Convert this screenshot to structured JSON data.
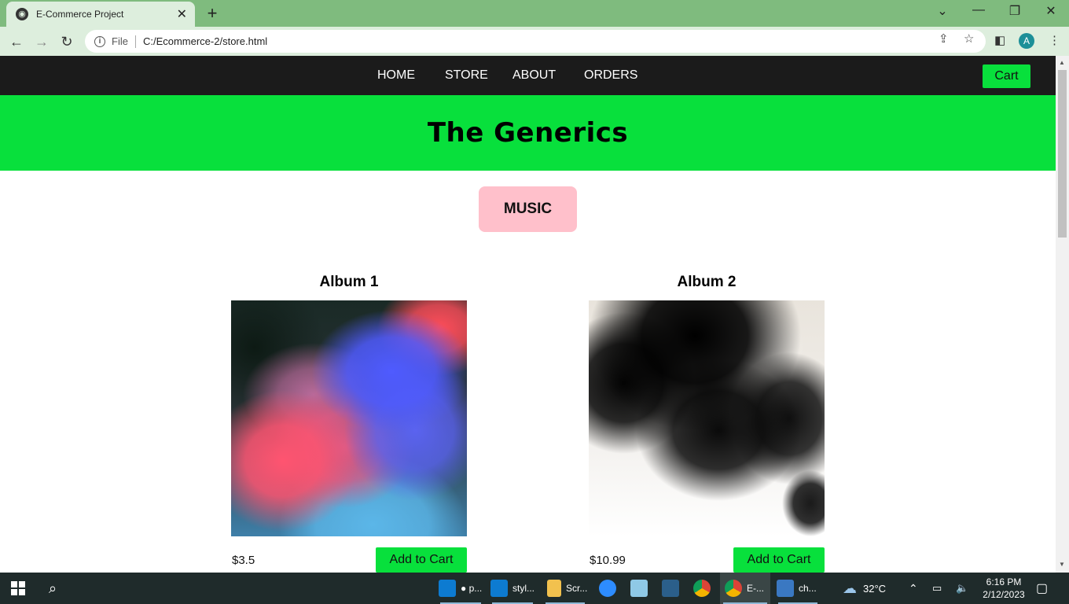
{
  "browser": {
    "tab_title": "E-Commerce Project",
    "url_scheme": "File",
    "url": "C:/Ecommerce-2/store.html",
    "profile_initial": "A"
  },
  "site": {
    "nav": [
      "HOME",
      "STORE",
      "ABOUT",
      "ORDERS"
    ],
    "cart_label": "Cart",
    "brand": "The Generics",
    "section": "MUSIC",
    "products": [
      {
        "title": "Album 1",
        "price": "$3.5",
        "button": "Add to Cart"
      },
      {
        "title": "Album 2",
        "price": "$10.99",
        "button": "Add to Cart"
      }
    ],
    "colors": {
      "nav_bg": "#1b1b1b",
      "accent_green": "#08e03c",
      "section_tag": "#ffc0cb"
    }
  },
  "taskbar": {
    "apps": [
      {
        "label": "● p...",
        "icon": "vscode-icon"
      },
      {
        "label": "styl...",
        "icon": "vscode-icon"
      },
      {
        "label": "Scr...",
        "icon": "folder-icon"
      },
      {
        "label": "",
        "icon": "zoom-icon"
      },
      {
        "label": "",
        "icon": "notepad-icon"
      },
      {
        "label": "",
        "icon": "sql-workbench-icon"
      },
      {
        "label": "",
        "icon": "chrome-icon"
      },
      {
        "label": "E-...",
        "icon": "chrome-icon"
      },
      {
        "label": "ch...",
        "icon": "photos-icon"
      }
    ],
    "weather": "32°C",
    "time": "6:16 PM",
    "date": "2/12/2023"
  }
}
